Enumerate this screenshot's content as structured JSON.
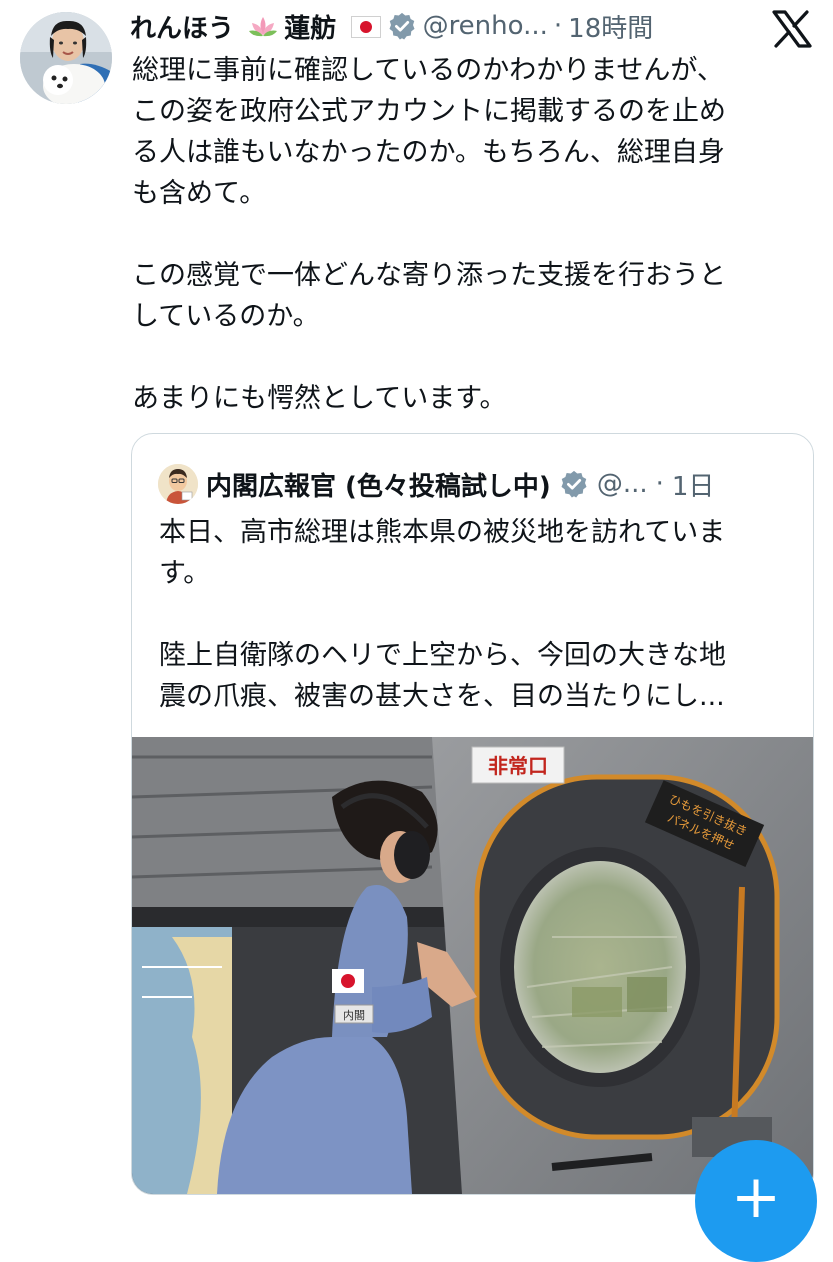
{
  "tweet": {
    "author_name": "れんほう",
    "author_kanji": "蓮舫",
    "author_emoji_lotus": "🪷",
    "author_emoji_flag": "🇯🇵",
    "handle": "@renho...",
    "separator": "·",
    "time": "18時間",
    "text": "総理に事前に確認しているのかわかりませんが、\nこの姿を政府公式アカウントに掲載するのを止め\nる人は誰もいなかったのか。もちろん、総理自身\nも含めて。\n\nこの感覚で一体どんな寄り添った支援を行おうと\nしているのか。\n\nあまりにも愕然としています。"
  },
  "quote": {
    "author_name": "内閣広報官 (色々投稿試し中)",
    "handle": "@...",
    "separator": "·",
    "time": "1日",
    "text": "本日、高市総理は熊本県の被災地を訪れていま\nす。\n\n陸上自衛隊のヘリで上空から、今回の大きな地\n震の爪痕、被害の甚大さを、目の当たりにし...",
    "photo_signs": {
      "exit_sign": "非常口",
      "instruction_line1": "ひもを引き抜き",
      "instruction_line2": "パネルを押せ",
      "badge": "内閣"
    }
  },
  "fab": {
    "label": "+"
  },
  "icons": {
    "verified": "verified-badge-icon",
    "x_logo": "x-logo-icon"
  },
  "colors": {
    "verified": "#829aab",
    "link_blue": "#1d9bf0",
    "secondary_text": "#536471",
    "border": "#cfd9de"
  }
}
